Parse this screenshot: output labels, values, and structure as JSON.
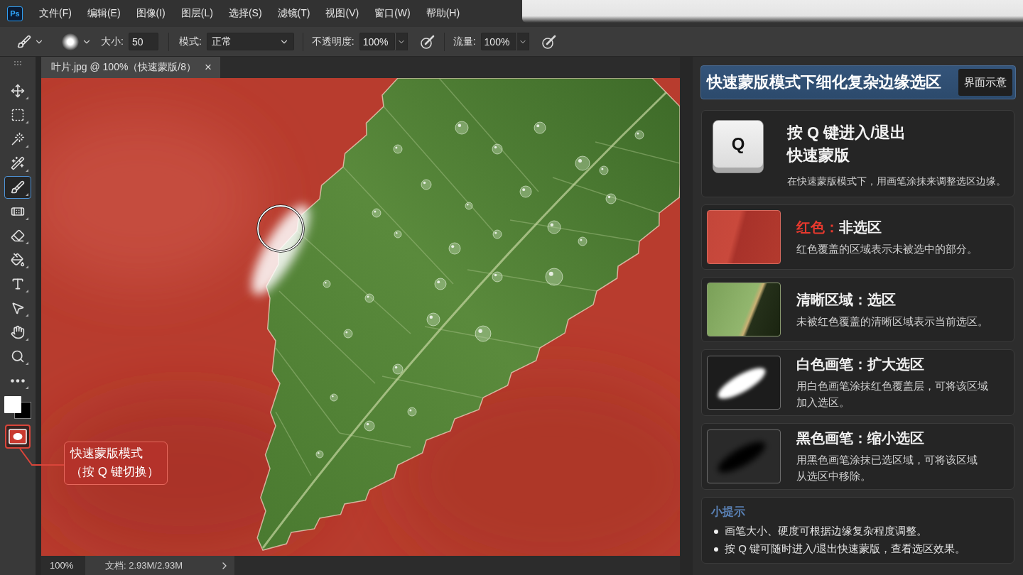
{
  "menu_bar": {
    "logo": "Ps",
    "items": [
      "文件(F)",
      "编辑(E)",
      "图像(I)",
      "图层(L)",
      "选择(S)",
      "滤镜(T)",
      "视图(V)",
      "窗口(W)",
      "帮助(H)"
    ]
  },
  "options_bar": {
    "size_label": "大小:",
    "size": "50",
    "mode_label": "模式:",
    "mode": "正常",
    "opacity_label": "不透明度:",
    "opacity": "100%",
    "flow_label": "流量:",
    "flow": "100%"
  },
  "document_tab": {
    "title": "叶片.jpg @ 100%（快速蒙版/8）",
    "close": "×"
  },
  "toolbar": {
    "tools": [
      {
        "kind": "move",
        "selected": false
      },
      {
        "kind": "marquee",
        "selected": false
      },
      {
        "kind": "quick_select",
        "selected": false
      },
      {
        "kind": "magic_wand",
        "selected": false
      },
      {
        "kind": "brush",
        "selected": true
      },
      {
        "kind": "healing",
        "selected": false
      },
      {
        "kind": "eraser",
        "selected": false
      },
      {
        "kind": "fill",
        "selected": false
      },
      {
        "kind": "type",
        "selected": false
      },
      {
        "kind": "path_select",
        "selected": false
      },
      {
        "kind": "hand",
        "selected": false
      },
      {
        "kind": "zoom",
        "selected": false
      },
      {
        "kind": "more",
        "selected": false
      }
    ],
    "quick_mask": {
      "on": true
    }
  },
  "callout": {
    "lines": [
      "快速蒙版模式",
      "（按 Q 键切换）"
    ]
  },
  "status_bar": {
    "zoom": "100%",
    "document": "文档: 2.93M/2.93M"
  },
  "guide_panel": {
    "title": "快速蒙版模式下细化复杂边缘选区",
    "badge": "界面示意",
    "key_card": {
      "key": "Q",
      "title_lines": [
        "按 Q 键进入/退出",
        "快速蒙版"
      ],
      "description": "在快速蒙版模式下，用画笔涂抹来调整选区边缘。"
    },
    "cards": [
      {
        "kind": "red_overlay",
        "title_highlight": "红色：",
        "title": "非选区",
        "description_lines": [
          "红色覆盖的区域表示未被选中的部分。"
        ]
      },
      {
        "kind": "leaf",
        "title": "清晰区域：选区",
        "description_lines": [
          "未被红色覆盖的清晰区域表示当前选区。"
        ]
      },
      {
        "kind": "white_stroke",
        "title": "白色画笔：扩大选区",
        "description_lines": [
          "用白色画笔涂抹红色覆盖层，可将该区域",
          "加入选区。"
        ]
      },
      {
        "kind": "black_stroke",
        "title": "黑色画笔：缩小选区",
        "description_lines": [
          "用黑色画笔涂抹已选区域，可将该区域",
          "从选区中移除。"
        ]
      }
    ],
    "tips": {
      "title": "小提示",
      "items": [
        "画笔大小、硬度可根据边缘复杂程度调整。",
        "按 Q 键可随时进入/退出快速蒙版，查看选区效果。"
      ]
    }
  }
}
